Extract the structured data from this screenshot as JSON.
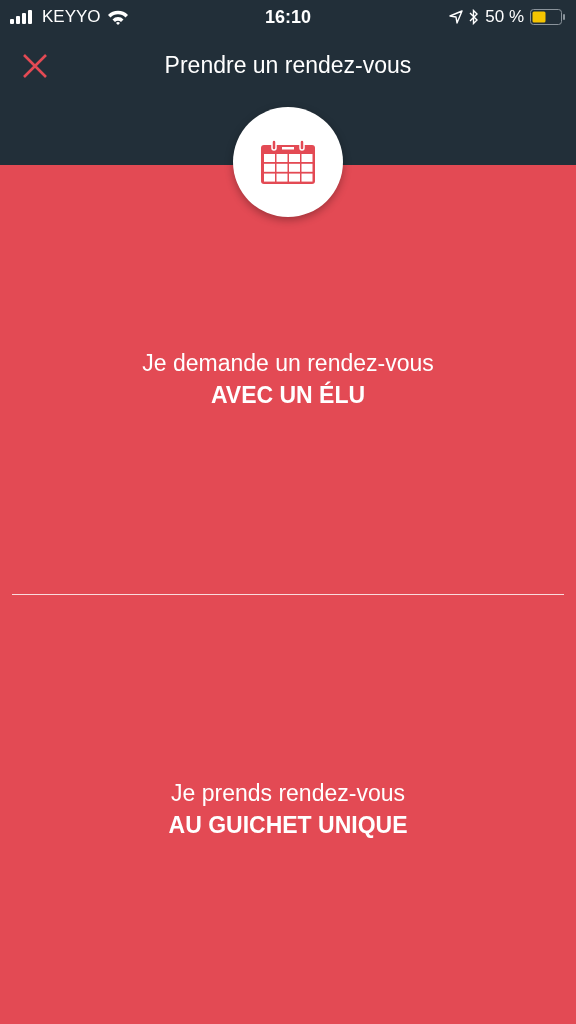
{
  "status_bar": {
    "carrier": "KEYYO",
    "time": "16:10",
    "battery": "50 %"
  },
  "header": {
    "title": "Prendre un rendez-vous"
  },
  "options": [
    {
      "line": "Je demande un rendez-vous",
      "emphasis": "AVEC UN ÉLU"
    },
    {
      "line": "Je prends rendez-vous",
      "emphasis": "AU GUICHET UNIQUE"
    }
  ]
}
